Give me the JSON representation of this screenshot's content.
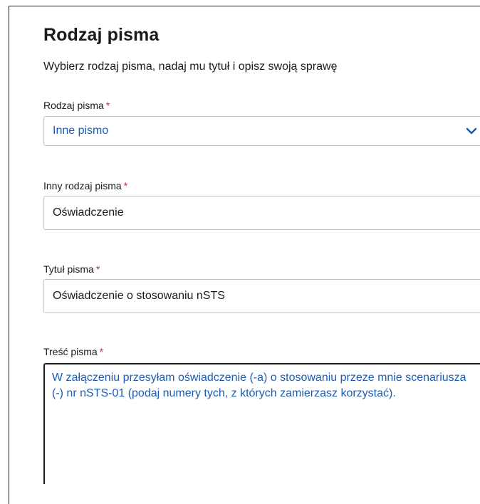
{
  "section": {
    "title": "Rodzaj pisma",
    "subtitle": "Wybierz rodzaj pisma, nadaj mu tytuł i opisz swoją sprawę"
  },
  "fields": {
    "letter_type": {
      "label": "Rodzaj pisma",
      "required_mark": "*",
      "value": "Inne pismo",
      "icon": "chevron-down-icon"
    },
    "other_type": {
      "label": "Inny rodzaj pisma",
      "required_mark": "*",
      "value": "Oświadczenie"
    },
    "letter_title": {
      "label": "Tytuł pisma",
      "required_mark": "*",
      "value": "Oświadczenie o stosowaniu nSTS"
    },
    "letter_content": {
      "label": "Treść pisma",
      "required_mark": "*",
      "value": "W załączeniu przesyłam oświadczenie (-a) o stosowaniu przeze mnie scenariusza (-) nr nSTS-01 (podaj numery tych, z których zamierzasz korzystać)."
    }
  },
  "colors": {
    "accent": "#1a5db5",
    "required": "#c62828",
    "border": "#c4c4c4",
    "text": "#1b1b1b"
  }
}
